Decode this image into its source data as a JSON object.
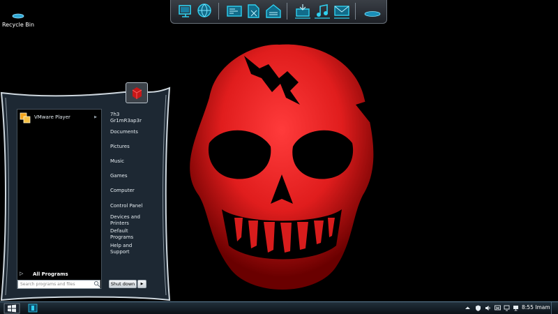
{
  "desktop": {
    "icons": [
      {
        "label": "Recycle Bin",
        "icon": "recycle-bin-icon"
      }
    ],
    "wallpaper": {
      "subject": "red-skull",
      "background_color": "#000000",
      "skull_color": "#e01d1d"
    }
  },
  "dock": {
    "groups": [
      [
        "computer-icon",
        "network-globe-icon"
      ],
      [
        "control-panel-icon",
        "documents-icon",
        "home-folder-icon"
      ],
      [
        "downloads-icon",
        "music-icon",
        "mail-icon"
      ],
      [
        "disc-icon"
      ]
    ],
    "accent_color": "#2fd0f0"
  },
  "start_menu": {
    "user_name": "7h3 Gr1mR3ap3r",
    "programs": [
      {
        "label": "VMware Player",
        "icon": "vmware-player-icon",
        "has_submenu": true
      }
    ],
    "all_programs_label": "All Programs",
    "search_placeholder": "Search programs and files",
    "right_items": [
      {
        "key": "documents",
        "label": "Documents"
      },
      {
        "key": "pictures",
        "label": "Pictures"
      },
      {
        "key": "music",
        "label": "Music"
      },
      {
        "key": "games",
        "label": "Games"
      },
      {
        "key": "computer",
        "label": "Computer"
      },
      {
        "key": "control-panel",
        "label": "Control Panel"
      },
      {
        "key": "devices-printers",
        "label": "Devices and Printers"
      },
      {
        "key": "default-programs",
        "label": "Default Programs"
      },
      {
        "key": "help-support",
        "label": "Help and Support"
      }
    ],
    "shutdown_label": "Shut down",
    "frame_color": "#cfd8df",
    "panel_color": "#1d2833"
  },
  "taskbar": {
    "start_icon": "windows-orb-icon",
    "pinned": [
      {
        "icon": "explorer-icon"
      }
    ],
    "tray_icons": [
      "show-hidden-icons-icon",
      "security-icon",
      "volume-icon",
      "network-icon",
      "action-center-icon",
      "display-icon"
    ],
    "clock": "8:55 Imam"
  }
}
